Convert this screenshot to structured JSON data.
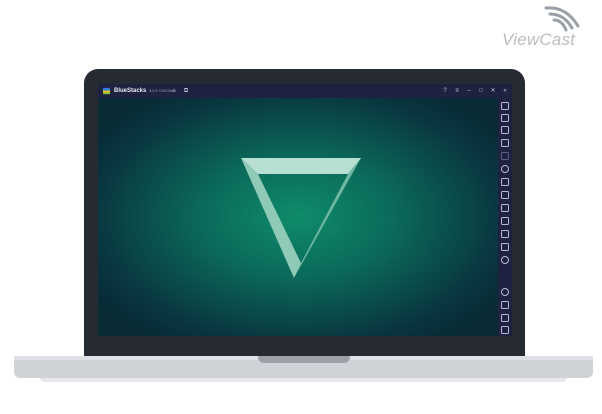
{
  "brand": {
    "name": "ViewCast"
  },
  "window": {
    "app_name": "BlueStacks",
    "app_version": "5.0.0.7228 Beta",
    "controls": [
      "help-icon",
      "menu-icon",
      "minimize-icon",
      "maximize-icon",
      "close-icon",
      "collapse-icon"
    ]
  },
  "sidebar": {
    "icons": [
      "fullscreen-icon",
      "volume-up-icon",
      "volume-down-icon",
      "keyboard-icon",
      "camera-icon",
      "rotate-icon",
      "gamepad-icon",
      "macro-icon",
      "screenshot-icon",
      "folder-icon",
      "multi-instance-icon",
      "layers-icon",
      "eco-icon",
      "settings-icon",
      "back-icon",
      "home-icon",
      "recent-apps-icon"
    ]
  },
  "colors": {
    "screen_accent": "#0e8b6b",
    "titlebar": "#1e2140",
    "logo_mark": "#a9d6c8"
  }
}
